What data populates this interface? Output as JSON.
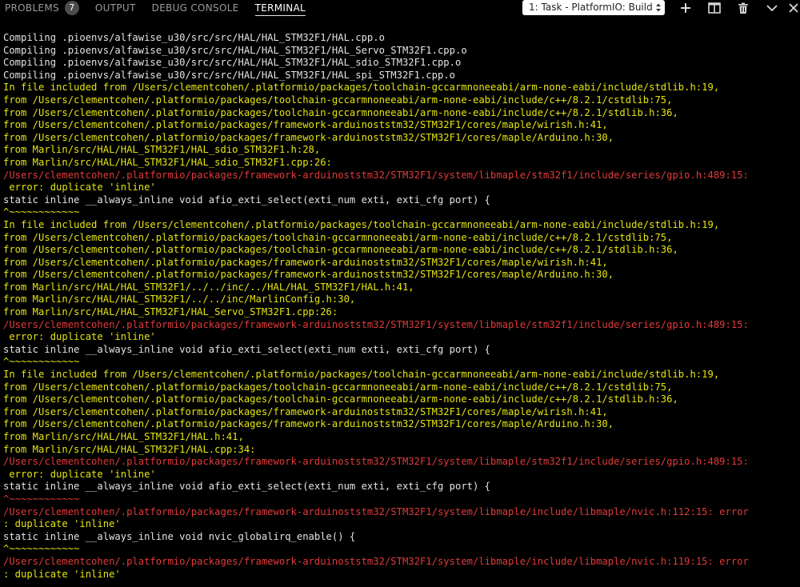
{
  "panel": {
    "tabs": [
      {
        "label": "PROBLEMS",
        "badge": "7"
      },
      {
        "label": "OUTPUT"
      },
      {
        "label": "DEBUG CONSOLE"
      },
      {
        "label": "TERMINAL"
      }
    ],
    "task_select": "1: Task - PlatformIO: Build",
    "actions": [
      "plus-icon",
      "split-terminal-icon",
      "trash-icon",
      "chevron-down-icon",
      "close-icon"
    ]
  },
  "colors": {
    "normal": "#e4e4e4",
    "include": "#e5e510",
    "error": "#e23a3a"
  },
  "terminal": {
    "lines": [
      {
        "text": "Compiling .pioenvs/alfawise_u30/src/src/HAL/HAL_STM32F1/HAL.cpp.o",
        "type": "normal"
      },
      {
        "text": "Compiling .pioenvs/alfawise_u30/src/src/HAL/HAL_STM32F1/HAL_Servo_STM32F1.cpp.o",
        "type": "normal"
      },
      {
        "text": "Compiling .pioenvs/alfawise_u30/src/src/HAL/HAL_STM32F1/HAL_sdio_STM32F1.cpp.o",
        "type": "normal"
      },
      {
        "text": "Compiling .pioenvs/alfawise_u30/src/src/HAL/HAL_STM32F1/HAL_spi_STM32F1.cpp.o",
        "type": "normal"
      },
      {
        "text": "In file included from /Users/clementcohen/.platformio/packages/toolchain-gccarmnoneeabi/arm-none-eabi/include/stdlib.h:19,",
        "type": "include"
      },
      {
        "text": "from /Users/clementcohen/.platformio/packages/toolchain-gccarmnoneeabi/arm-none-eabi/include/c++/8.2.1/cstdlib:75,",
        "type": "include"
      },
      {
        "text": "from /Users/clementcohen/.platformio/packages/toolchain-gccarmnoneeabi/arm-none-eabi/include/c++/8.2.1/stdlib.h:36,",
        "type": "include"
      },
      {
        "text": "from /Users/clementcohen/.platformio/packages/framework-arduinoststm32/STM32F1/cores/maple/wirish.h:41,",
        "type": "include"
      },
      {
        "text": "from /Users/clementcohen/.platformio/packages/framework-arduinoststm32/STM32F1/cores/maple/Arduino.h:30,",
        "type": "include"
      },
      {
        "text": "from Marlin/src/HAL/HAL_STM32F1/HAL_sdio_STM32F1.h:28,",
        "type": "include"
      },
      {
        "text": "from Marlin/src/HAL/HAL_STM32F1/HAL_sdio_STM32F1.cpp:26:",
        "type": "include"
      },
      {
        "text": "/Users/clementcohen/.platformio/packages/framework-arduinoststm32/STM32F1/system/libmaple/stm32f1/include/series/gpio.h:489:15:",
        "type": "error"
      },
      {
        "text": " error: duplicate 'inline'",
        "type": "include"
      },
      {
        "text": "static inline __always_inline void afio_exti_select(exti_num exti, exti_cfg port) {",
        "type": "normal"
      },
      {
        "text": "^~~~~~~~~~~~~",
        "type": "include"
      },
      {
        "text": "In file included from /Users/clementcohen/.platformio/packages/toolchain-gccarmnoneeabi/arm-none-eabi/include/stdlib.h:19,",
        "type": "include"
      },
      {
        "text": "from /Users/clementcohen/.platformio/packages/toolchain-gccarmnoneeabi/arm-none-eabi/include/c++/8.2.1/cstdlib:75,",
        "type": "include"
      },
      {
        "text": "from /Users/clementcohen/.platformio/packages/toolchain-gccarmnoneeabi/arm-none-eabi/include/c++/8.2.1/stdlib.h:36,",
        "type": "include"
      },
      {
        "text": "from /Users/clementcohen/.platformio/packages/framework-arduinoststm32/STM32F1/cores/maple/wirish.h:41,",
        "type": "include"
      },
      {
        "text": "from /Users/clementcohen/.platformio/packages/framework-arduinoststm32/STM32F1/cores/maple/Arduino.h:30,",
        "type": "include"
      },
      {
        "text": "from Marlin/src/HAL/HAL_STM32F1/../../inc/../HAL/HAL_STM32F1/HAL.h:41,",
        "type": "include"
      },
      {
        "text": "from Marlin/src/HAL/HAL_STM32F1/../../inc/MarlinConfig.h:30,",
        "type": "include"
      },
      {
        "text": "from Marlin/src/HAL/HAL_STM32F1/HAL_Servo_STM32F1.cpp:26:",
        "type": "include"
      },
      {
        "text": "/Users/clementcohen/.platformio/packages/framework-arduinoststm32/STM32F1/system/libmaple/stm32f1/include/series/gpio.h:489:15:",
        "type": "error"
      },
      {
        "text": " error: duplicate 'inline'",
        "type": "include"
      },
      {
        "text": "static inline __always_inline void afio_exti_select(exti_num exti, exti_cfg port) {",
        "type": "normal"
      },
      {
        "text": "^~~~~~~~~~~~~",
        "type": "include"
      },
      {
        "text": "In file included from /Users/clementcohen/.platformio/packages/toolchain-gccarmnoneeabi/arm-none-eabi/include/stdlib.h:19,",
        "type": "include"
      },
      {
        "text": "from /Users/clementcohen/.platformio/packages/toolchain-gccarmnoneeabi/arm-none-eabi/include/c++/8.2.1/cstdlib:75,",
        "type": "include"
      },
      {
        "text": "from /Users/clementcohen/.platformio/packages/toolchain-gccarmnoneeabi/arm-none-eabi/include/c++/8.2.1/stdlib.h:36,",
        "type": "include"
      },
      {
        "text": "from /Users/clementcohen/.platformio/packages/framework-arduinoststm32/STM32F1/cores/maple/wirish.h:41,",
        "type": "include"
      },
      {
        "text": "from /Users/clementcohen/.platformio/packages/framework-arduinoststm32/STM32F1/cores/maple/Arduino.h:30,",
        "type": "include"
      },
      {
        "text": "from Marlin/src/HAL/HAL_STM32F1/HAL.h:41,",
        "type": "include"
      },
      {
        "text": "from Marlin/src/HAL/HAL_STM32F1/HAL.cpp:34:",
        "type": "include"
      },
      {
        "text": "/Users/clementcohen/.platformio/packages/framework-arduinoststm32/STM32F1/system/libmaple/stm32f1/include/series/gpio.h:489:15:",
        "type": "error"
      },
      {
        "text": " error: duplicate 'inline'",
        "type": "include"
      },
      {
        "text": "static inline __always_inline void afio_exti_select(exti_num exti, exti_cfg port) {",
        "type": "normal"
      },
      {
        "text": "^~~~~~~~~~~~~",
        "type": "error"
      },
      {
        "text": "/Users/clementcohen/.platformio/packages/framework-arduinoststm32/STM32F1/system/libmaple/include/libmaple/nvic.h:112:15: error",
        "type": "error"
      },
      {
        "text": ": duplicate 'inline'",
        "type": "include"
      },
      {
        "text": "static inline __always_inline void nvic_globalirq_enable() {",
        "type": "normal"
      },
      {
        "text": "^~~~~~~~~~~~~",
        "type": "include"
      },
      {
        "text": "/Users/clementcohen/.platformio/packages/framework-arduinoststm32/STM32F1/system/libmaple/include/libmaple/nvic.h:119:15: error",
        "type": "error"
      },
      {
        "text": ": duplicate 'inline'",
        "type": "include"
      }
    ]
  }
}
